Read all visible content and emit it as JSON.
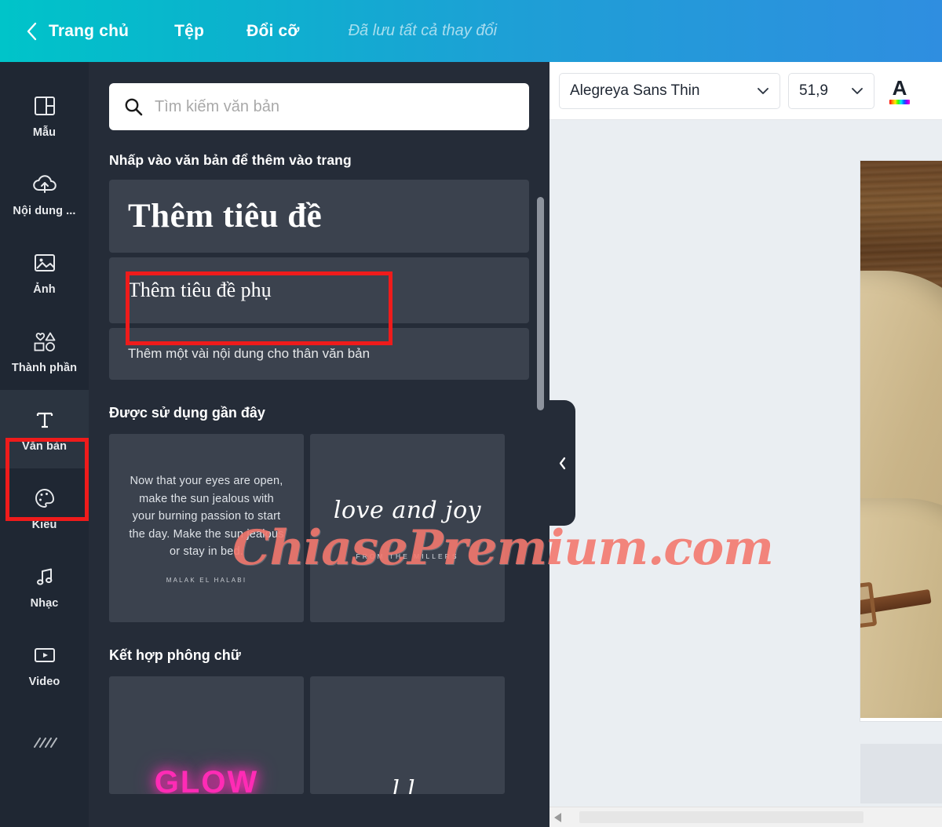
{
  "topbar": {
    "back_icon": "chevron-left-icon",
    "home": "Trang chủ",
    "file": "Tệp",
    "resize": "Đổi cỡ",
    "save_status": "Đã lưu tất cả thay đổi",
    "gradient_from": "#00c4c9",
    "gradient_to": "#2f8ee0"
  },
  "rail": {
    "items": [
      {
        "label": "Mẫu",
        "icon": "templates-icon"
      },
      {
        "label": "Nội dung ...",
        "icon": "cloud-upload-icon"
      },
      {
        "label": "Ảnh",
        "icon": "image-icon"
      },
      {
        "label": "Thành phần",
        "icon": "shapes-icon"
      },
      {
        "label": "Văn bản",
        "icon": "text-T-icon"
      },
      {
        "label": "Kiểu",
        "icon": "palette-icon"
      },
      {
        "label": "Nhạc",
        "icon": "music-note-icon"
      },
      {
        "label": "Video",
        "icon": "video-icon"
      }
    ],
    "active_label": "Văn bản",
    "highlight_color": "#ef1b1b"
  },
  "panel": {
    "search": {
      "icon": "search-icon",
      "placeholder": "Tìm kiếm văn bản",
      "value": ""
    },
    "add_heading_label": "Nhấp vào văn bản để thêm vào trang",
    "presets": [
      {
        "label": "Thêm tiêu đề",
        "kind": "heading"
      },
      {
        "label": "Thêm tiêu đề phụ",
        "kind": "subheading"
      },
      {
        "label": "Thêm một vài nội dung cho thân văn bản",
        "kind": "body"
      }
    ],
    "highlighted_preset": "Thêm tiêu đề phụ",
    "recent_section_title": "Được sử dụng gần đây",
    "recent_cards": [
      {
        "name": "quote-card",
        "text": "Now that your eyes are open, make the sun jealous with your burning passion to start the day. Make the sun jealous or stay in bed.",
        "author": "MALAK EL HALABI"
      },
      {
        "name": "love-and-joy-card",
        "text": "love and joy",
        "author": "FROM THE MILLERS"
      }
    ],
    "font_combo_section_title": "Kết hợp phông chữ",
    "font_combo_cards": [
      {
        "name": "neon-glow-card",
        "text": "GLOW"
      },
      {
        "name": "script-card",
        "text": "ll"
      }
    ],
    "collapse_icon": "chevron-left-icon"
  },
  "toolbar": {
    "font_family": "Alegreya Sans Thin",
    "font_size": "51,9",
    "dropdown_icon": "chevron-down-icon",
    "text_color_icon": "text-color-A-icon"
  },
  "canvas": {
    "page_name": "design-page",
    "photo_alt": "canvas-bag-on-wood-photo"
  },
  "watermark": {
    "text": "ChiasePremium.com",
    "color": "#f3746a"
  }
}
